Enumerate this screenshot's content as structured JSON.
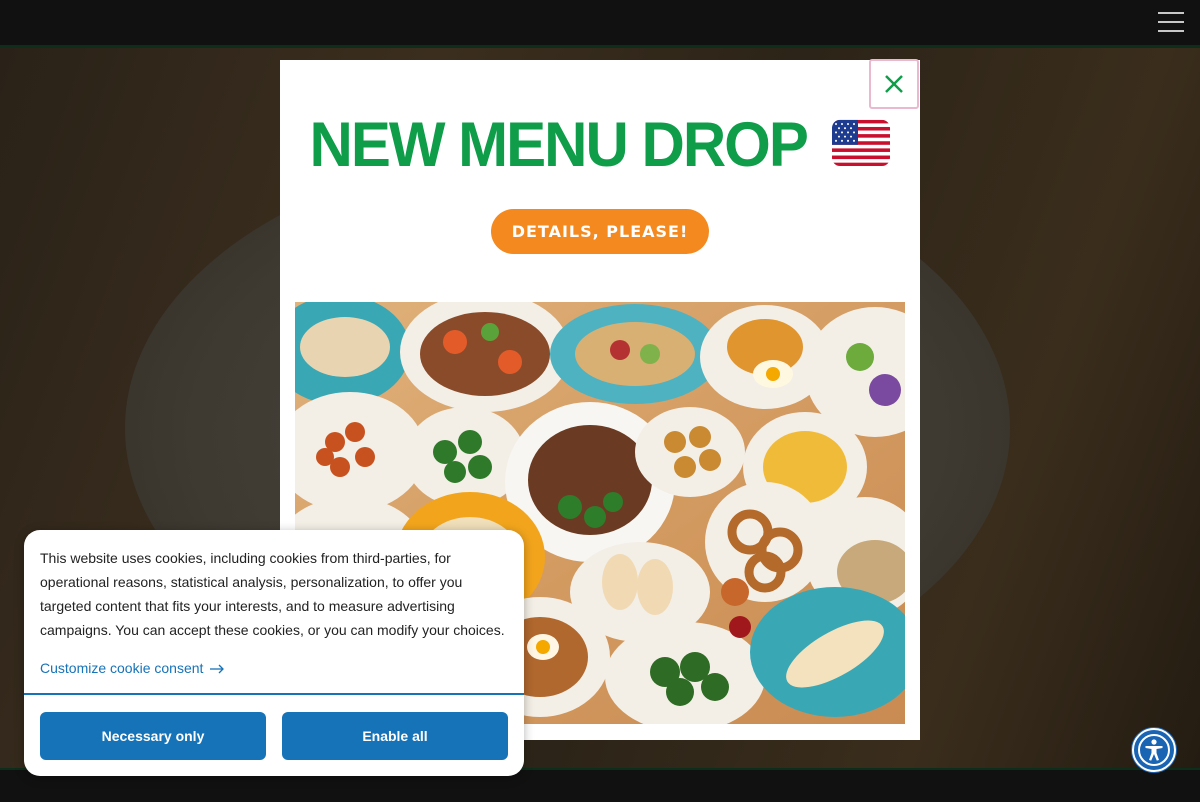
{
  "header": {
    "menu_icon": "hamburger-menu-icon"
  },
  "modal": {
    "title": "NEW MENU DROP",
    "flag_icon": "us-flag-icon",
    "cta_label": "DETAILS, PLEASE!",
    "close_icon": "close-icon",
    "image_icon": "food-spread-image",
    "colors": {
      "title": "#0f9d4a",
      "cta": "#f4891f"
    }
  },
  "cookie": {
    "text": "This website uses cookies, including cookies from third-parties, for operational reasons, statistical analysis, personalization, to offer you targeted content that fits your interests, and to measure advertising campaigns. You can accept these cookies, or you can modify your choices.",
    "customize_label": "Customize cookie consent",
    "arrow_icon": "arrow-right-icon",
    "necessary_label": "Necessary only",
    "enable_label": "Enable all",
    "accent": "#1673b8"
  },
  "accessibility": {
    "icon": "accessibility-icon"
  }
}
